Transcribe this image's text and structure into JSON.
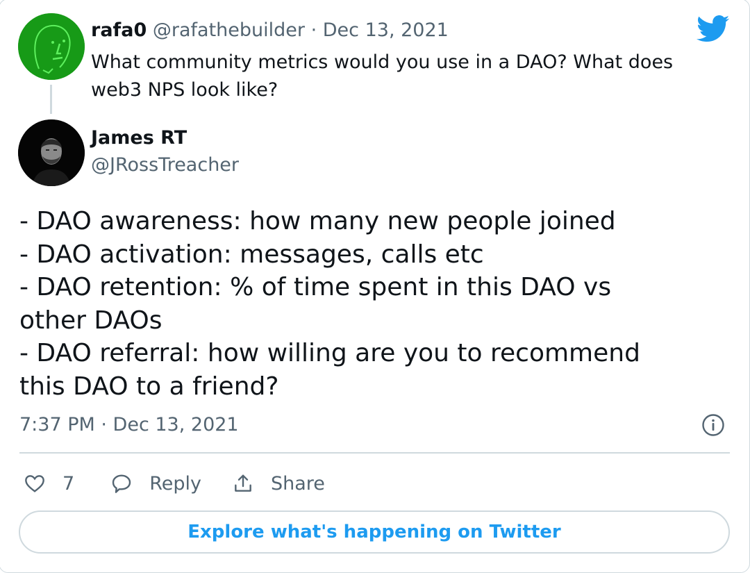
{
  "quoted_tweet": {
    "author_name": "rafa0",
    "author_handle": "@rafathebuilder",
    "separator": " · ",
    "date": "Dec 13, 2021",
    "text": "What community metrics would you use in a DAO? What does web3 NPS look like?"
  },
  "tweet": {
    "author_name": "James RT",
    "author_handle": "@JRossTreacher",
    "lines": [
      "- DAO awareness: how many new people joined",
      "- DAO activation: messages, calls etc",
      "- DAO retention: % of time spent in this DAO vs other DAOs",
      "- DAO referral: how willing are you to recommend this DAO to a friend?"
    ],
    "timestamp": "7:37 PM · Dec 13, 2021"
  },
  "actions": {
    "like_count": "7",
    "reply_label": "Reply",
    "share_label": "Share"
  },
  "explore_button": "Explore what's happening on Twitter",
  "icons": {
    "brand": "twitter-bird-icon",
    "info": "info-icon",
    "like": "heart-icon",
    "reply": "speech-bubble-icon",
    "share": "share-upload-icon"
  },
  "colors": {
    "accent": "#1d9bf0",
    "secondary_text": "#536471",
    "border": "#cfd9de"
  }
}
